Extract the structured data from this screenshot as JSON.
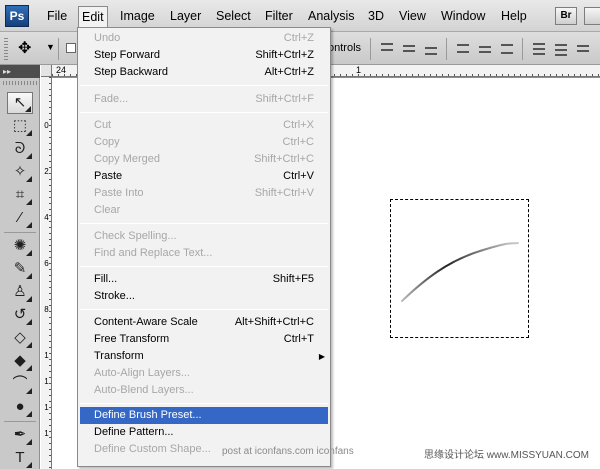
{
  "app": {
    "logo": "Ps"
  },
  "menubar": {
    "items": [
      "File",
      "Edit",
      "Image",
      "Layer",
      "Select",
      "Filter",
      "Analysis",
      "3D",
      "View",
      "Window",
      "Help"
    ],
    "bridge_label": "Br"
  },
  "options": {
    "controls_label": "ontrols"
  },
  "rulers": {
    "top_start": "24",
    "top_next": "1",
    "left": [
      "0",
      "2",
      "4",
      "6",
      "8",
      "1",
      "1",
      "1",
      "1"
    ]
  },
  "tools": [
    {
      "icon": "move-icon",
      "glyph": "↖"
    },
    {
      "icon": "marquee-icon",
      "glyph": "⬚"
    },
    {
      "icon": "lasso-icon",
      "glyph": "ᘐ"
    },
    {
      "icon": "magic-wand-icon",
      "glyph": "✧"
    },
    {
      "icon": "crop-icon",
      "glyph": "⌗"
    },
    {
      "icon": "eyedropper-icon",
      "glyph": "⁄"
    },
    {
      "icon": "healing-icon",
      "glyph": "✺"
    },
    {
      "icon": "brush-icon",
      "glyph": "✎"
    },
    {
      "icon": "stamp-icon",
      "glyph": "♙"
    },
    {
      "icon": "history-brush-icon",
      "glyph": "↺"
    },
    {
      "icon": "eraser-icon",
      "glyph": "◇"
    },
    {
      "icon": "paint-bucket-icon",
      "glyph": "◆"
    },
    {
      "icon": "blur-icon",
      "glyph": "⌒"
    },
    {
      "icon": "dodge-icon",
      "glyph": "●"
    },
    {
      "icon": "pen-icon",
      "glyph": "✒"
    },
    {
      "icon": "type-icon",
      "glyph": "T"
    }
  ],
  "edit_menu": {
    "items": [
      {
        "label": "Undo",
        "shortcut": "Ctrl+Z",
        "disabled": true
      },
      {
        "label": "Step Forward",
        "shortcut": "Shift+Ctrl+Z",
        "disabled": false
      },
      {
        "label": "Step Backward",
        "shortcut": "Alt+Ctrl+Z",
        "disabled": false
      },
      {
        "label": "Fade...",
        "shortcut": "Shift+Ctrl+F",
        "disabled": true
      },
      {
        "label": "Cut",
        "shortcut": "Ctrl+X",
        "disabled": true
      },
      {
        "label": "Copy",
        "shortcut": "Ctrl+C",
        "disabled": true
      },
      {
        "label": "Copy Merged",
        "shortcut": "Shift+Ctrl+C",
        "disabled": true
      },
      {
        "label": "Paste",
        "shortcut": "Ctrl+V",
        "disabled": false
      },
      {
        "label": "Paste Into",
        "shortcut": "Shift+Ctrl+V",
        "disabled": true
      },
      {
        "label": "Clear",
        "shortcut": "",
        "disabled": true
      },
      {
        "label": "Check Spelling...",
        "shortcut": "",
        "disabled": true
      },
      {
        "label": "Find and Replace Text...",
        "shortcut": "",
        "disabled": true
      },
      {
        "label": "Fill...",
        "shortcut": "Shift+F5",
        "disabled": false
      },
      {
        "label": "Stroke...",
        "shortcut": "",
        "disabled": false
      },
      {
        "label": "Content-Aware Scale",
        "shortcut": "Alt+Shift+Ctrl+C",
        "disabled": false
      },
      {
        "label": "Free Transform",
        "shortcut": "Ctrl+T",
        "disabled": false
      },
      {
        "label": "Transform",
        "shortcut": "",
        "disabled": false,
        "submenu": true
      },
      {
        "label": "Auto-Align Layers...",
        "shortcut": "",
        "disabled": true
      },
      {
        "label": "Auto-Blend Layers...",
        "shortcut": "",
        "disabled": true
      },
      {
        "label": "Define Brush Preset...",
        "shortcut": "",
        "disabled": false,
        "highlighted": true
      },
      {
        "label": "Define Pattern...",
        "shortcut": "",
        "disabled": false
      },
      {
        "label": "Define Custom Shape...",
        "shortcut": "",
        "disabled": true
      }
    ]
  },
  "watermarks": {
    "left": "post at iconfans.com  iconfans",
    "right": "思缘设计论坛 www.MISSYUAN.COM"
  },
  "colors": {
    "highlight": "#3568c6",
    "disabled_text": "#a7a7a7"
  }
}
